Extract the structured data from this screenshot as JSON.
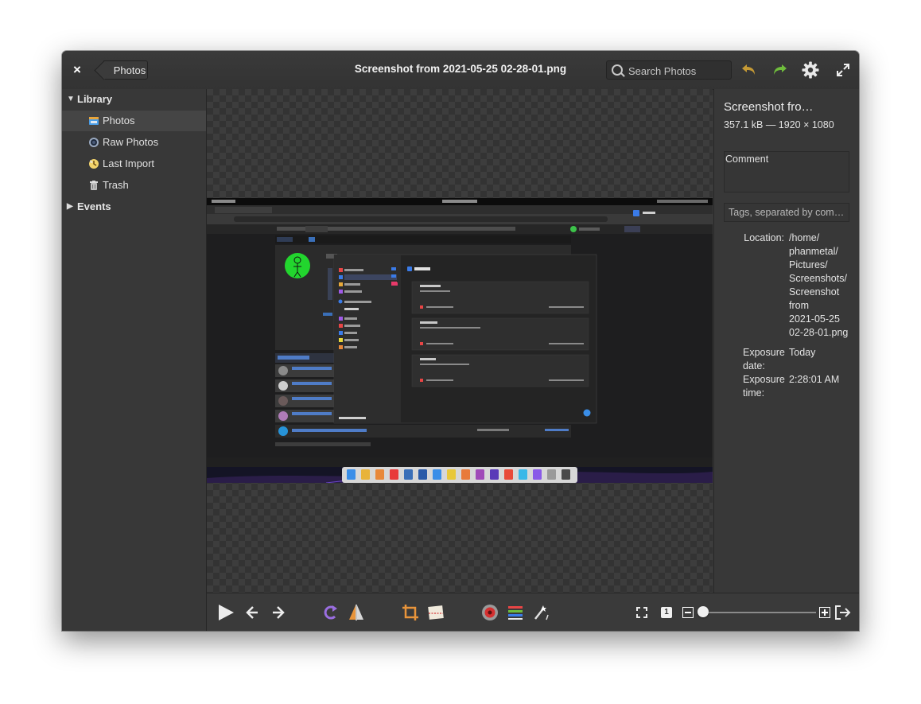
{
  "header": {
    "close_label": "×",
    "back_label": "Photos",
    "title": "Screenshot from 2021-05-25 02-28-01.png",
    "search_placeholder": "Search Photos"
  },
  "sidebar": {
    "library_label": "Library",
    "items": [
      {
        "label": "Photos",
        "icon": "photos-icon",
        "selected": true
      },
      {
        "label": "Raw Photos",
        "icon": "raw-photos-icon",
        "selected": false
      },
      {
        "label": "Last Import",
        "icon": "last-import-icon",
        "selected": false
      },
      {
        "label": "Trash",
        "icon": "trash-icon",
        "selected": false
      }
    ],
    "events_label": "Events"
  },
  "info": {
    "filename": "Screenshot fro…",
    "size_dims": "357.1 kB — 1920 × 1080",
    "comment_label": "Comment",
    "tags_placeholder": "Tags, separated by com…",
    "location_key": "Location:",
    "location_lines": [
      "/home/",
      "phanmetal/",
      "Pictures/",
      "Screenshots/",
      "Screenshot",
      "from",
      "2021-05-25",
      "02-28-01.png"
    ],
    "date_key_lines": [
      "Exposure",
      "date:"
    ],
    "date_value": "Today",
    "time_key_lines": [
      "Exposure",
      "time:"
    ],
    "time_value": "2:28:01 AM"
  },
  "toolbar": {
    "zoom_fraction": 0.04,
    "zoom_one_label": "1"
  },
  "colors": {
    "window_bg": "#3a3a3a",
    "accent_green": "#6fbd3c",
    "undo_amber": "#c59a35"
  }
}
